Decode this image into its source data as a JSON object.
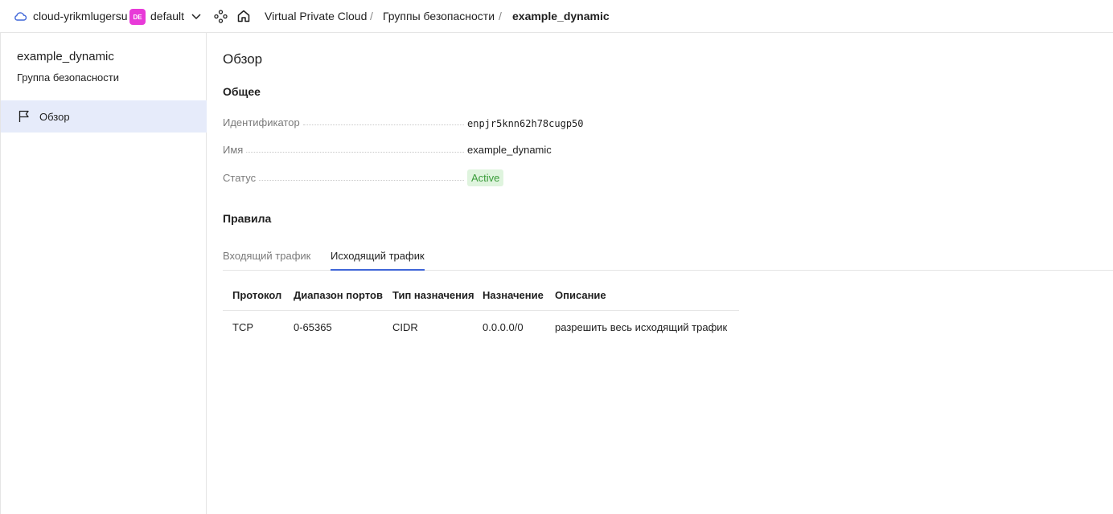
{
  "header": {
    "cloud_name": "cloud-yrikmlugersu",
    "folder_badge": "DE",
    "folder_name": "default",
    "breadcrumbs": [
      "Virtual Private Cloud",
      "Группы безопасности",
      "example_dynamic"
    ],
    "separator": "/"
  },
  "sidebar": {
    "title": "example_dynamic",
    "subtitle": "Группа безопасности",
    "items": [
      {
        "label": "Обзор",
        "icon": "flag-icon",
        "active": true
      }
    ]
  },
  "main": {
    "page_title": "Обзор",
    "general": {
      "title": "Общее",
      "properties": [
        {
          "label": "Идентификатор",
          "value": "enpjr5knn62h78cugp50"
        },
        {
          "label": "Имя",
          "value": "example_dynamic"
        },
        {
          "label": "Статус",
          "value": "Active"
        }
      ]
    },
    "rules": {
      "title": "Правила",
      "tabs": [
        {
          "label": "Входящий трафик",
          "active": false
        },
        {
          "label": "Исходящий трафик",
          "active": true
        }
      ],
      "columns": [
        "Протокол",
        "Диапазон портов",
        "Тип назначения",
        "Назначение",
        "Описание"
      ],
      "rows": [
        [
          "TCP",
          "0-65365",
          "CIDR",
          "0.0.0.0/0",
          "разрешить весь исходящий трафик"
        ]
      ]
    }
  },
  "colors": {
    "accent": "#3f66d8",
    "active_sidebar_bg": "#e6ebfa",
    "folder_badge_bg": "#e83ad8",
    "status_bg": "#dff4de",
    "status_text": "#3a9c3a"
  }
}
